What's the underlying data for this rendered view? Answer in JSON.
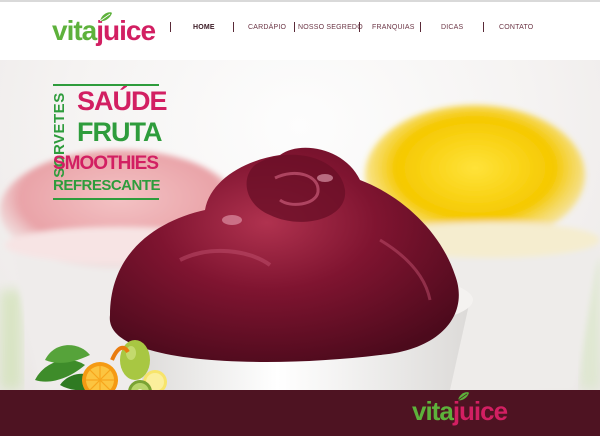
{
  "brand": {
    "vita": "vita",
    "juice": "juice",
    "primary_green": "#5db13b",
    "primary_pink": "#d21f62"
  },
  "nav": {
    "items": [
      {
        "label": "HOME",
        "active": true
      },
      {
        "label": "CARDÁPIO",
        "active": false
      },
      {
        "label": "NOSSO SEGREDO",
        "active": false
      },
      {
        "label": "FRANQUIAS",
        "active": false
      },
      {
        "label": "DICAS",
        "active": false
      },
      {
        "label": "CONTATO",
        "active": false
      }
    ]
  },
  "hero": {
    "tagline": {
      "vertical": "SORVETES",
      "lines": [
        "SAÚDE",
        "FRUTA",
        "SMOOTHIES",
        "REFRESCANTE"
      ]
    }
  },
  "footer": {
    "background": "#4e1322"
  }
}
